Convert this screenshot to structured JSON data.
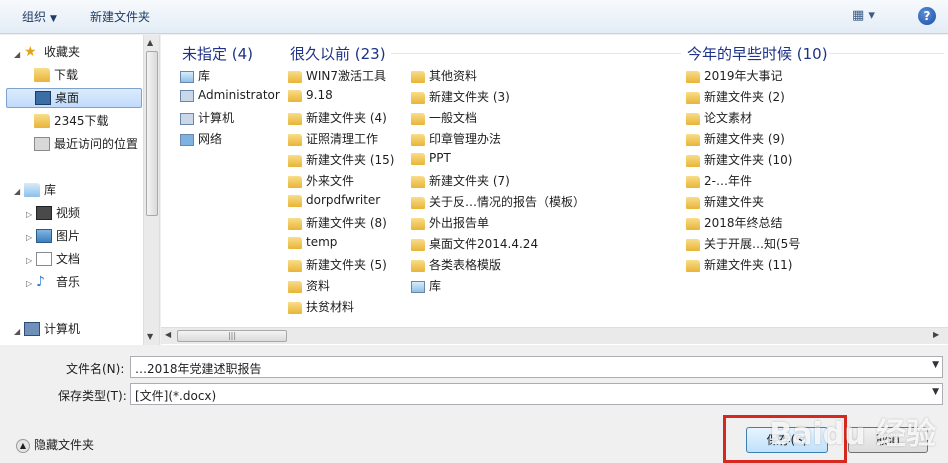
{
  "toolbar": {
    "organize": "组织",
    "new_folder": "新建文件夹",
    "view_icon": "view-options-icon",
    "help": "?"
  },
  "nav": {
    "favorites": "收藏夹",
    "downloads": "下载",
    "desktop": "桌面",
    "downloads2345": "2345下载",
    "recent": "最近访问的位置",
    "libraries": "库",
    "videos": "视频",
    "pictures": "图片",
    "documents": "文档",
    "music": "音乐",
    "computer": "计算机"
  },
  "groups": [
    {
      "title": "未指定 (4)",
      "items": [
        "库",
        "Administrator",
        "计算机",
        "网络"
      ]
    },
    {
      "title": "很久以前 (23)",
      "col1": [
        "WIN7激活工具",
        "9.18",
        "新建文件夹 (4)",
        "证照清理工作",
        "新建文件夹 (15)",
        "外来文件",
        "dorpdfwriter",
        "新建文件夹 (8)",
        "temp",
        "新建文件夹 (5)",
        "资料",
        "扶贫材料"
      ],
      "col2": [
        "其他资料",
        "新建文件夹 (3)",
        "一般文档",
        "印章管理办法",
        "PPT",
        "新建文件夹 (7)",
        "关于反…情况的报告（模板）",
        "外出报告单",
        "桌面文件2014.4.24",
        "各类表格模版",
        "库"
      ]
    },
    {
      "title": "今年的早些时候 (10)",
      "items": [
        "2019年大事记",
        "新建文件夹 (2)",
        "论文素材",
        "新建文件夹 (9)",
        "新建文件夹 (10)",
        "2-…年件",
        "新建文件夹",
        "2018年终总结",
        "关于开展…知(5号",
        "新建文件夹 (11)"
      ]
    }
  ],
  "form": {
    "filename_label": "文件名(N):",
    "filename_value": "…2018年党建述职报告",
    "type_label": "保存类型(T):",
    "type_value": "[文件](*.docx)",
    "hide_folders": "隐藏文件夹",
    "save": "保存(S)",
    "cancel": "取消"
  },
  "watermark": "Baidu 经验"
}
